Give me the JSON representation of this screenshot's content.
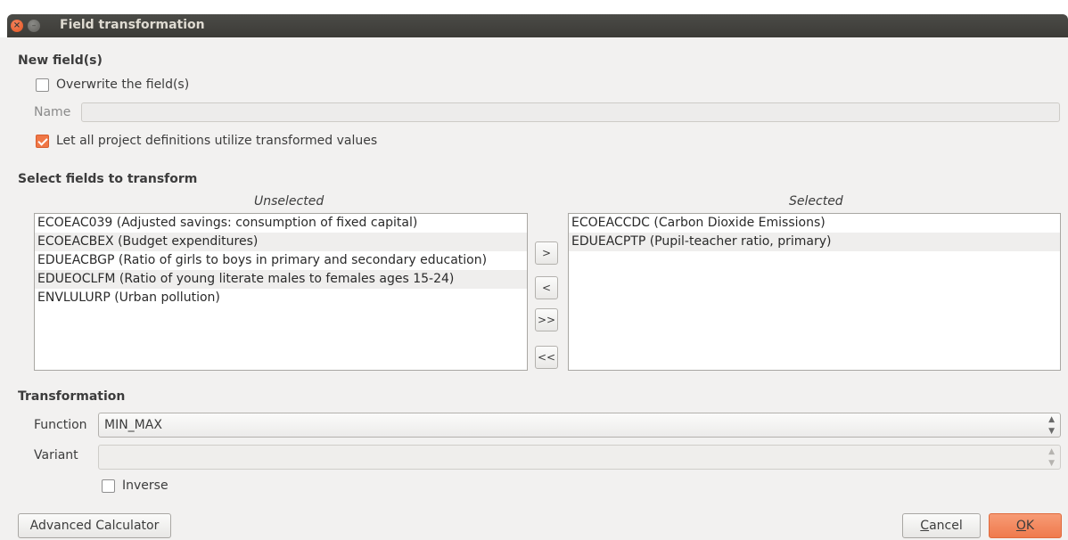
{
  "window": {
    "title": "Field transformation",
    "close_glyph": "×",
    "minimize_glyph": "–"
  },
  "new_fields": {
    "section_title": "New field(s)",
    "overwrite_label": "Overwrite the field(s)",
    "overwrite_checked": false,
    "name_label": "Name",
    "name_value": "",
    "let_all_label": "Let all project definitions utilize transformed values",
    "let_all_checked": true
  },
  "select_fields": {
    "section_title": "Select fields to transform",
    "unselected_header": "Unselected",
    "selected_header": "Selected",
    "unselected_items": [
      "ECOEAC039 (Adjusted savings: consumption of fixed capital)",
      "ECOEACBEX (Budget expenditures)",
      "EDUEACBGP (Ratio of girls to boys in primary and secondary education)",
      "EDUEOCLFM (Ratio of young literate males to females ages  15-24)",
      "ENVLULURP (Urban pollution)"
    ],
    "selected_items": [
      "ECOEACCDC (Carbon Dioxide Emissions)",
      "EDUEACPTP (Pupil-teacher ratio, primary)"
    ],
    "buttons": {
      "add": ">",
      "remove": "<",
      "add_all": ">>",
      "remove_all": "<<"
    }
  },
  "transformation": {
    "section_title": "Transformation",
    "function_label": "Function",
    "function_value": "MIN_MAX",
    "variant_label": "Variant",
    "variant_value": "",
    "inverse_label": "Inverse",
    "inverse_checked": false
  },
  "footer": {
    "advanced_calculator": "Advanced Calculator",
    "cancel": "Cancel",
    "ok": "OK"
  },
  "colors": {
    "accent": "#f07746",
    "titlebar": "#3c3b37",
    "background": "#f2f1f0"
  }
}
